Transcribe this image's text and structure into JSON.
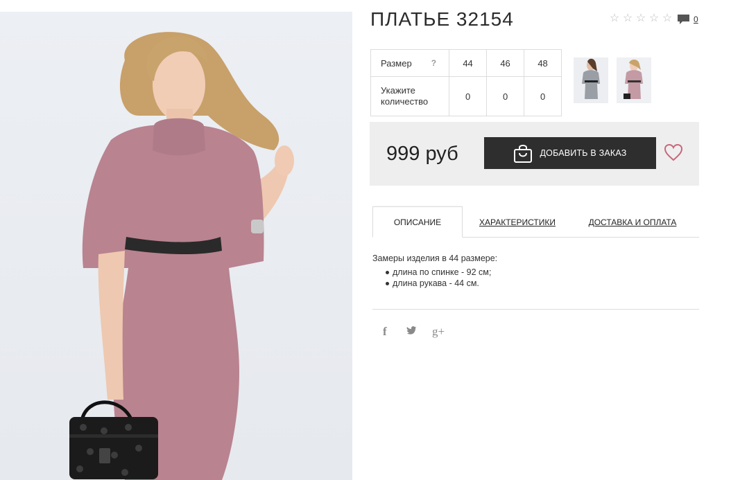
{
  "product": {
    "title": "ПЛАТЬЕ 32154",
    "rating_icon": "star-outline-icon",
    "comments_count": "0"
  },
  "sizes": {
    "size_label": "Размер",
    "help": "?",
    "qty_label": "Укажите количество",
    "options": [
      "44",
      "46",
      "48"
    ],
    "quantities": [
      "0",
      "0",
      "0"
    ]
  },
  "purchase": {
    "price": "999 руб",
    "add_button": "ДОБАВИТЬ В ЗАКАЗ",
    "cart_icon": "shopping-bag-icon",
    "wish_icon": "heart-icon"
  },
  "tabs": [
    "ОПИСАНИЕ",
    "ХАРАКТЕРИСТИКИ",
    "ДОСТАВКА И ОПЛАТА"
  ],
  "description": {
    "intro": "Замеры изделия в 44 размере:",
    "items": [
      "длина по спинке - 92 см;",
      "длина рукава - 44 см."
    ]
  },
  "social": {
    "facebook": "f",
    "twitter": "🐦",
    "googleplus": "g+"
  },
  "colors": {
    "dress": "#b98390",
    "button": "#2e2e2e",
    "heart": "#c8677a",
    "price_bg": "#eeeeee"
  }
}
